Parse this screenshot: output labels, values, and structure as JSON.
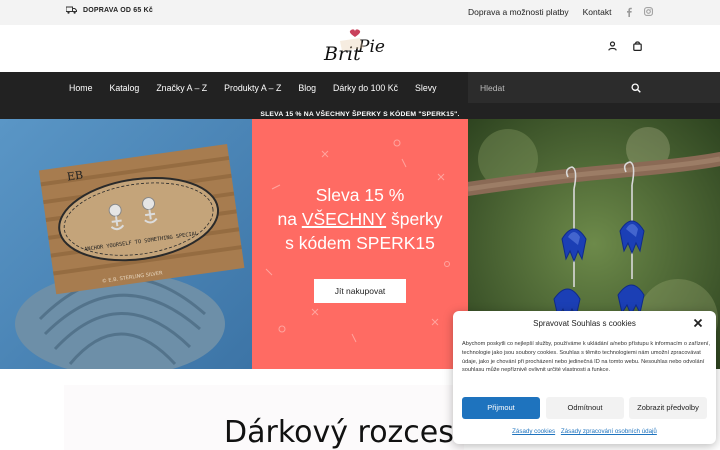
{
  "topbar": {
    "shipping_text": "DOPRAVA OD 65 Kč",
    "links": [
      "Doprava a možnosti platby",
      "Kontakt"
    ],
    "social": [
      "facebook-icon",
      "instagram-icon"
    ]
  },
  "header": {
    "logo_text": "Brit Pie",
    "icons": [
      "user-icon",
      "bag-icon"
    ]
  },
  "nav": {
    "items": [
      "Home",
      "Katalog",
      "Značky A – Z",
      "Produkty A – Z",
      "Blog",
      "Dárky do 100 Kč",
      "Slevy"
    ],
    "search_placeholder": "Hledat"
  },
  "promo_strip": "SLEVA 15 % NA VŠECHNY ŠPERKY S KÓDEM \"SPERK15\".",
  "hero": {
    "left_card_text": "ANCHOR YOURSELF TO SOMETHING SPECIAL",
    "left_card_footer": "© E.B. STERLING SILVER",
    "left_card_monogram": "EB",
    "promo_line1": "Sleva 15 %",
    "promo_line2_pre": "na ",
    "promo_line2_u": "VŠECHNY",
    "promo_line2_post": " šperky",
    "promo_line3": "s kódem SPERK15",
    "shop_button": "Jít nakupovat"
  },
  "section_title": "Dárkový rozcestník",
  "cookie": {
    "title": "Spravovat Souhlas s cookies",
    "body": "Abychom poskytli co nejlepší služby, používáme k ukládání a/nebo přístupu k informacím o zařízení, technologie jako jsou soubory cookies. Souhlas s těmito technologiemi nám umožní zpracovávat údaje, jako je chování při procházení nebo jedinečná ID na tomto webu. Nesouhlas nebo odvolání souhlasu může nepříznivě ovlivnit určité vlastnosti a funkce.",
    "accept": "Přijmout",
    "deny": "Odmítnout",
    "preferences": "Zobrazit předvolby",
    "link1": "Zásady cookies",
    "link2": "Zásady zpracování osobních údajů"
  },
  "colors": {
    "nav_bg": "#222222",
    "promo_panel": "#ff6b63",
    "accept_button": "#1e73be"
  }
}
